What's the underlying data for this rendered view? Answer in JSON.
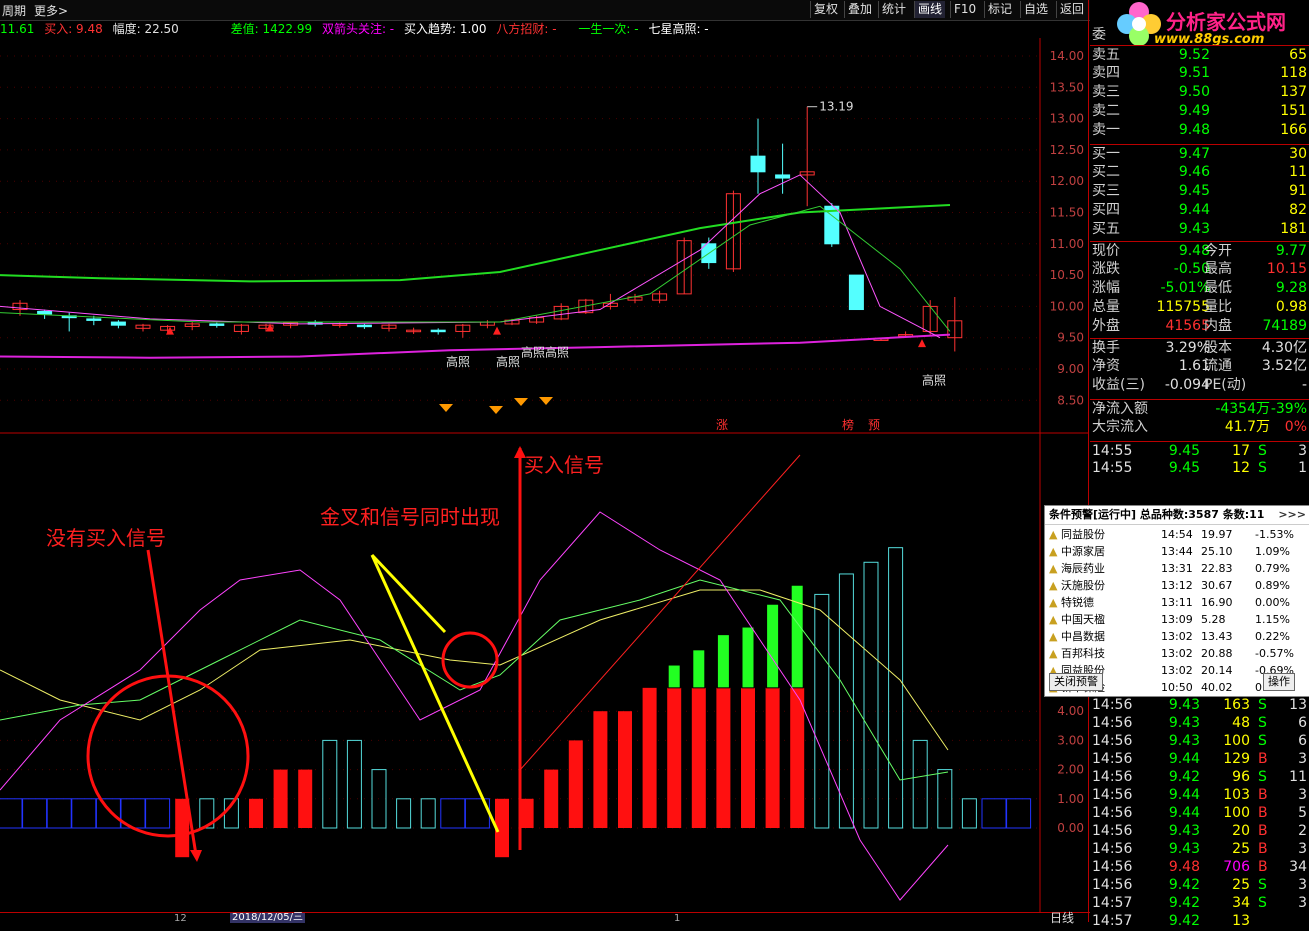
{
  "toolbar": {
    "left_items": [
      "周期",
      "更多>"
    ],
    "right_items": [
      "复权",
      "叠加",
      "统计",
      "画线",
      "F10",
      "标记",
      "自选",
      "返回"
    ]
  },
  "legend": {
    "open_val": "11.61",
    "buy": "买入: 9.48",
    "range": "幅度: 22.50",
    "diff": "差值: 1422.99",
    "arrow": "双箭头关注: -",
    "trend": "买入趋势: 1.00",
    "eight": "八方招财: -",
    "once": "一生一次: -",
    "seven": "七星高照: -"
  },
  "price_axis": [
    "14.00",
    "13.50",
    "13.00",
    "12.50",
    "12.00",
    "11.50",
    "11.00",
    "10.50",
    "10.00",
    "9.50",
    "9.00",
    "8.50"
  ],
  "indicator_axis": [
    "4.00",
    "3.00",
    "2.00",
    "1.00",
    "0.00"
  ],
  "chart_data": {
    "type": "candlestick",
    "candles": [
      {
        "o": 9.95,
        "c": 10.05,
        "h": 10.1,
        "l": 9.85
      },
      {
        "o": 9.92,
        "c": 9.88,
        "h": 9.95,
        "l": 9.8
      },
      {
        "o": 9.85,
        "c": 9.82,
        "h": 9.9,
        "l": 9.6
      },
      {
        "o": 9.8,
        "c": 9.78,
        "h": 9.85,
        "l": 9.7
      },
      {
        "o": 9.75,
        "c": 9.7,
        "h": 9.78,
        "l": 9.65
      },
      {
        "o": 9.65,
        "c": 9.7,
        "h": 9.72,
        "l": 9.6
      },
      {
        "o": 9.62,
        "c": 9.68,
        "h": 9.7,
        "l": 9.55
      },
      {
        "o": 9.68,
        "c": 9.72,
        "h": 9.75,
        "l": 9.62
      },
      {
        "o": 9.72,
        "c": 9.7,
        "h": 9.74,
        "l": 9.66
      },
      {
        "o": 9.6,
        "c": 9.7,
        "h": 9.72,
        "l": 9.55
      },
      {
        "o": 9.65,
        "c": 9.7,
        "h": 9.72,
        "l": 9.6
      },
      {
        "o": 9.7,
        "c": 9.74,
        "h": 9.76,
        "l": 9.65
      },
      {
        "o": 9.74,
        "c": 9.72,
        "h": 9.78,
        "l": 9.68
      },
      {
        "o": 9.7,
        "c": 9.72,
        "h": 9.74,
        "l": 9.66
      },
      {
        "o": 9.7,
        "c": 9.68,
        "h": 9.72,
        "l": 9.64
      },
      {
        "o": 9.65,
        "c": 9.7,
        "h": 9.72,
        "l": 9.6
      },
      {
        "o": 9.6,
        "c": 9.62,
        "h": 9.66,
        "l": 9.56
      },
      {
        "o": 9.62,
        "c": 9.6,
        "h": 9.65,
        "l": 9.55
      },
      {
        "o": 9.6,
        "c": 9.7,
        "h": 9.72,
        "l": 9.5
      },
      {
        "o": 9.7,
        "c": 9.75,
        "h": 9.78,
        "l": 9.65
      },
      {
        "o": 9.72,
        "c": 9.78,
        "h": 9.8,
        "l": 9.7
      },
      {
        "o": 9.75,
        "c": 9.82,
        "h": 9.85,
        "l": 9.72
      },
      {
        "o": 9.8,
        "c": 10.0,
        "h": 10.05,
        "l": 9.78
      },
      {
        "o": 9.9,
        "c": 10.1,
        "h": 10.12,
        "l": 9.88
      },
      {
        "o": 10.0,
        "c": 10.05,
        "h": 10.2,
        "l": 9.95
      },
      {
        "o": 10.1,
        "c": 10.15,
        "h": 10.2,
        "l": 10.05
      },
      {
        "o": 10.1,
        "c": 10.2,
        "h": 10.25,
        "l": 10.05
      },
      {
        "o": 10.2,
        "c": 11.05,
        "h": 11.1,
        "l": 10.2
      },
      {
        "o": 11.0,
        "c": 10.7,
        "h": 11.1,
        "l": 10.6
      },
      {
        "o": 10.6,
        "c": 11.8,
        "h": 11.85,
        "l": 10.55
      },
      {
        "o": 12.4,
        "c": 12.15,
        "h": 13.0,
        "l": 11.8
      },
      {
        "o": 12.1,
        "c": 12.05,
        "h": 12.6,
        "l": 11.8
      },
      {
        "o": 12.1,
        "c": 12.15,
        "h": 13.19,
        "l": 11.6
      },
      {
        "o": 11.6,
        "c": 11.0,
        "h": 11.65,
        "l": 10.95
      },
      {
        "o": 10.5,
        "c": 9.95,
        "h": 10.5,
        "l": 9.95
      },
      {
        "o": 9.48,
        "c": 9.48,
        "h": 9.5,
        "l": 9.45
      },
      {
        "o": 9.55,
        "c": 9.55,
        "h": 9.6,
        "l": 9.5
      },
      {
        "o": 9.6,
        "c": 10.0,
        "h": 10.1,
        "l": 9.55
      },
      {
        "o": 9.5,
        "c": 9.77,
        "h": 10.15,
        "l": 9.28
      }
    ],
    "high_label": "13.19",
    "annotations_price": [
      "高照",
      "高照",
      "高照高照",
      "高照",
      "涨",
      "榜",
      "预"
    ],
    "annotation_texts": {
      "no_signal": "没有买入信号",
      "golden_cross": "金叉和信号同时出现",
      "buy_signal": "买入信号"
    },
    "indicator_bars": [
      0.5,
      0.5,
      0.5,
      0.5,
      0.5,
      0.5,
      0.5,
      -1,
      1,
      1,
      1,
      2,
      2,
      3,
      3,
      2,
      1,
      1,
      0.5,
      0.5,
      -1,
      1,
      2,
      3,
      4,
      4,
      4.6,
      5.2,
      5.6,
      6,
      6.2,
      6.8,
      7.3,
      8,
      8.7,
      9.1,
      9.6,
      3,
      2,
      1,
      0.5,
      0.5
    ]
  },
  "quote": {
    "header": "委",
    "sells": [
      {
        "label": "卖五",
        "price": "9.52",
        "vol": "65"
      },
      {
        "label": "卖四",
        "price": "9.51",
        "vol": "118"
      },
      {
        "label": "卖三",
        "price": "9.50",
        "vol": "137"
      },
      {
        "label": "卖二",
        "price": "9.49",
        "vol": "151"
      },
      {
        "label": "卖一",
        "price": "9.48",
        "vol": "166"
      }
    ],
    "buys": [
      {
        "label": "买一",
        "price": "9.47",
        "vol": "30"
      },
      {
        "label": "买二",
        "price": "9.46",
        "vol": "11"
      },
      {
        "label": "买三",
        "price": "9.45",
        "vol": "91"
      },
      {
        "label": "买四",
        "price": "9.44",
        "vol": "82"
      },
      {
        "label": "买五",
        "price": "9.43",
        "vol": "181"
      }
    ],
    "stats": [
      {
        "l1": "现价",
        "v1": "9.48",
        "l2": "今开",
        "v2": "9.77"
      },
      {
        "l1": "涨跌",
        "v1": "-0.50",
        "l2": "最高",
        "v2": "10.15"
      },
      {
        "l1": "涨幅",
        "v1": "-5.01%",
        "l2": "最低",
        "v2": "9.28"
      },
      {
        "l1": "总量",
        "v1": "115755",
        "l2": "量比",
        "v2": "0.98"
      },
      {
        "l1": "外盘",
        "v1": "41565",
        "l2": "内盘",
        "v2": "74189"
      }
    ],
    "stats2": [
      {
        "l1": "换手",
        "v1": "3.29%",
        "l2": "股本",
        "v2": "4.30亿"
      },
      {
        "l1": "净资",
        "v1": "1.61",
        "l2": "流通",
        "v2": "3.52亿"
      },
      {
        "l1": "收益(三)",
        "v1": "-0.094",
        "l2": "PE(动)",
        "v2": "-"
      }
    ],
    "flow": [
      {
        "l": "净流入额",
        "v": "-4354万",
        "p": "-39%"
      },
      {
        "l": "大宗流入",
        "v": "41.7万",
        "p": "0%"
      }
    ]
  },
  "ticks": [
    {
      "t": "14:55",
      "p": "9.45",
      "v": "17",
      "s": "S",
      "n": "3"
    },
    {
      "t": "14:55",
      "p": "9.45",
      "v": "12",
      "s": "S",
      "n": "1"
    },
    {
      "t": "14:56",
      "p": "9.43",
      "v": "163",
      "s": "S",
      "n": "13"
    },
    {
      "t": "14:56",
      "p": "9.43",
      "v": "48",
      "s": "S",
      "n": "6"
    },
    {
      "t": "14:56",
      "p": "9.43",
      "v": "100",
      "s": "S",
      "n": "6"
    },
    {
      "t": "14:56",
      "p": "9.44",
      "v": "129",
      "s": "B",
      "n": "3"
    },
    {
      "t": "14:56",
      "p": "9.42",
      "v": "96",
      "s": "S",
      "n": "11"
    },
    {
      "t": "14:56",
      "p": "9.44",
      "v": "103",
      "s": "B",
      "n": "3"
    },
    {
      "t": "14:56",
      "p": "9.44",
      "v": "100",
      "s": "B",
      "n": "5"
    },
    {
      "t": "14:56",
      "p": "9.43",
      "v": "20",
      "s": "B",
      "n": "2"
    },
    {
      "t": "14:56",
      "p": "9.43",
      "v": "25",
      "s": "B",
      "n": "3"
    },
    {
      "t": "14:56",
      "p": "9.48",
      "v": "706",
      "s": "B",
      "n": "34"
    },
    {
      "t": "14:56",
      "p": "9.42",
      "v": "25",
      "s": "S",
      "n": "3"
    },
    {
      "t": "14:57",
      "p": "9.42",
      "v": "34",
      "s": "S",
      "n": "3"
    },
    {
      "t": "14:57",
      "p": "9.42",
      "v": "13",
      "s": "",
      "n": ""
    }
  ],
  "popup": {
    "title": "条件预警[运行中] 总品种数:3587 条数:11",
    "more": ">>>",
    "rows": [
      {
        "name": "同益股份",
        "time": "14:54",
        "price": "19.97",
        "pct": "-1.53%"
      },
      {
        "name": "中源家居",
        "time": "13:44",
        "price": "25.10",
        "pct": "1.09%"
      },
      {
        "name": "海辰药业",
        "time": "13:31",
        "price": "22.83",
        "pct": "0.79%"
      },
      {
        "name": "沃施股份",
        "time": "13:12",
        "price": "30.67",
        "pct": "0.89%"
      },
      {
        "name": "特锐德",
        "time": "13:11",
        "price": "16.90",
        "pct": "0.00%"
      },
      {
        "name": "中国天楹",
        "time": "13:09",
        "price": "5.28",
        "pct": "1.15%"
      },
      {
        "name": "中昌数据",
        "time": "13:02",
        "price": "13.43",
        "pct": "0.22%"
      },
      {
        "name": "百邦科技",
        "time": "13:02",
        "price": "20.88",
        "pct": "-0.57%"
      },
      {
        "name": "同益股份",
        "time": "13:02",
        "price": "20.14",
        "pct": "-0.69%"
      },
      {
        "name": "新华保险",
        "time": "10:50",
        "price": "40.02",
        "pct": "0.35%"
      }
    ],
    "close_label": "关闭预警",
    "op_label": "操作"
  },
  "bottom": {
    "date_label": "2018/12/05/三",
    "tab_label": "日线",
    "mark12": "12",
    "mark1": "1"
  },
  "logo": {
    "title": "分析家公式网",
    "url": "www.88gs.com"
  },
  "colors": {
    "up": "#ff3232",
    "down": "#54ffff",
    "green": "#00ff00",
    "magenta": "#ff00ff",
    "yellow": "#ffff00"
  }
}
